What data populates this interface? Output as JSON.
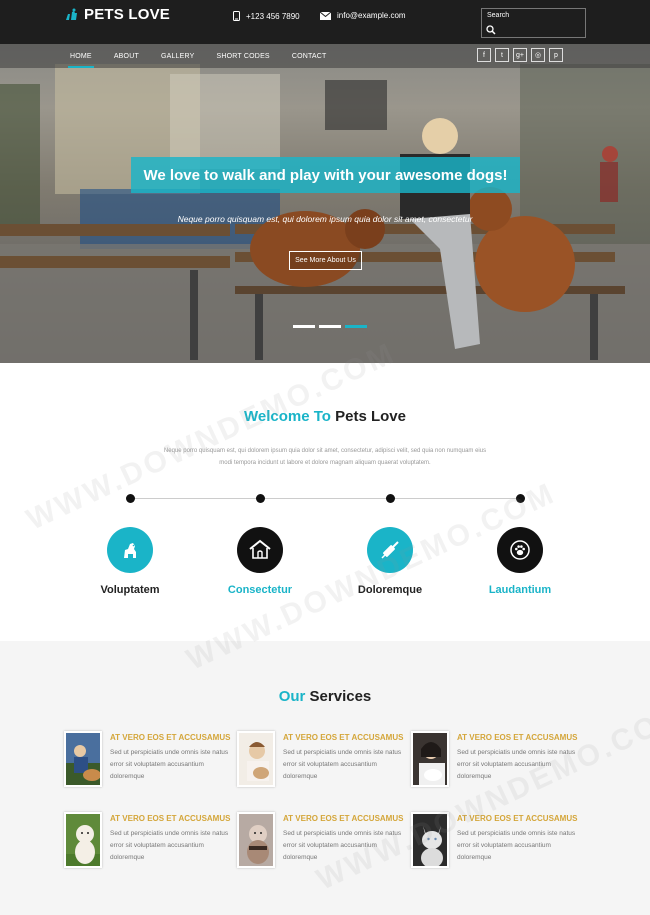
{
  "header": {
    "logo": "PETS LOVE",
    "phone": "+123 456 7890",
    "email": "info@example.com",
    "search_label": "Search"
  },
  "nav": {
    "items": [
      "HOME",
      "ABOUT",
      "GALLERY",
      "SHORT CODES",
      "CONTACT"
    ],
    "active": "HOME"
  },
  "social": [
    "f",
    "t",
    "g+",
    "◎",
    "p"
  ],
  "hero": {
    "title": "We love to walk and play with your awesome dogs!",
    "subtitle": "Neque porro quisquam est, qui dolorem ipsum quia dolor sit amet, consectetur",
    "button": "See More About Us",
    "slides": 3,
    "active_slide": 3
  },
  "welcome": {
    "title_a": "Welcome To",
    "title_b": "Pets Love",
    "text_1": "Neque porro quisquam est, qui dolorem ipsum quia dolor sit amet, consectetur, adipisci velit, sed quia non numquam eius",
    "text_2": "modi tempora incidunt ut labore et dolore magnam aliquam quaerat voluptatem.",
    "features": [
      {
        "label": "Voluptatem",
        "icon": "dog-icon",
        "accent": false
      },
      {
        "label": "Consectetur",
        "icon": "dog-house-icon",
        "accent": true
      },
      {
        "label": "Doloremque",
        "icon": "syringe-icon",
        "accent": false
      },
      {
        "label": "Laudantium",
        "icon": "paw-icon",
        "accent": true
      }
    ]
  },
  "services": {
    "title_a": "Our",
    "title_b": "Services",
    "items": [
      {
        "title": "AT VERO EOS ET ACCUSAMUS",
        "text": "Sed ut perspiciatis unde omnis iste natus error sit voluptatem accusantium doloremque"
      },
      {
        "title": "AT VERO EOS ET ACCUSAMUS",
        "text": "Sed ut perspiciatis unde omnis iste natus error sit voluptatem accusantium doloremque"
      },
      {
        "title": "AT VERO EOS ET ACCUSAMUS",
        "text": "Sed ut perspiciatis unde omnis iste natus error sit voluptatem accusantium doloremque"
      },
      {
        "title": "AT VERO EOS ET ACCUSAMUS",
        "text": "Sed ut perspiciatis unde omnis iste natus error sit voluptatem accusantium doloremque"
      },
      {
        "title": "AT VERO EOS ET ACCUSAMUS",
        "text": "Sed ut perspiciatis unde omnis iste natus error sit voluptatem accusantium doloremque"
      },
      {
        "title": "AT VERO EOS ET ACCUSAMUS",
        "text": "Sed ut perspiciatis unde omnis iste natus error sit voluptatem accusantium doloremque"
      }
    ]
  },
  "watermark": "WWW.DOWNDEMO.COM",
  "colors": {
    "accent": "#1ab4c8",
    "gold": "#d4a63a",
    "header_bg": "#1e1e1e"
  }
}
